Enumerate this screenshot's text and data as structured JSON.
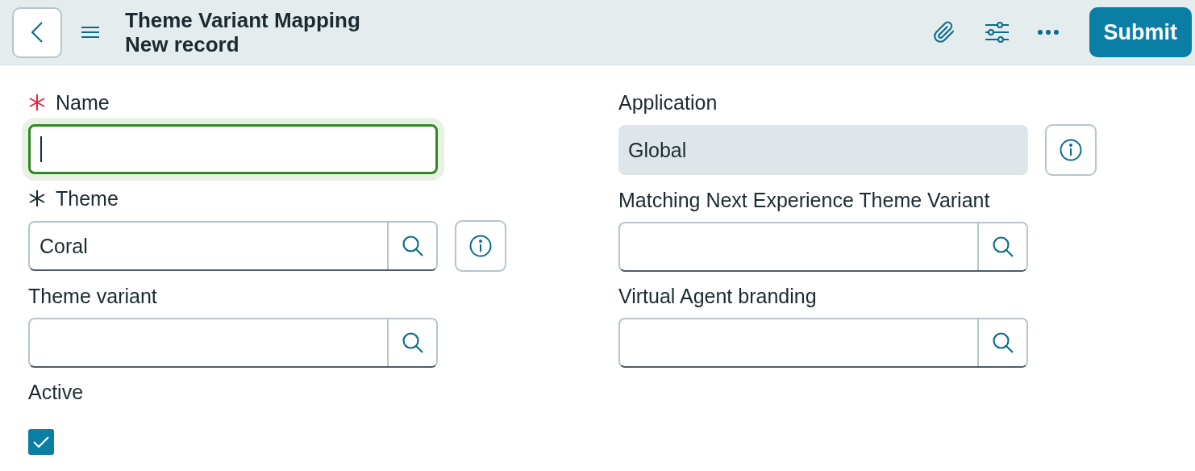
{
  "header": {
    "title": "Theme Variant Mapping",
    "subtitle": "New record",
    "submit": "Submit"
  },
  "columns": [
    {
      "fields": [
        {
          "kind": "text",
          "label": "Name",
          "required": true,
          "focused": true
        },
        {
          "kind": "reference",
          "label": "Theme",
          "required": true,
          "value": "Coral",
          "info": true
        },
        {
          "kind": "reference",
          "label": "Theme variant"
        },
        {
          "kind": "checkbox",
          "label": "Active",
          "checked": true
        }
      ]
    },
    {
      "fields": [
        {
          "kind": "readonly",
          "label": "Application",
          "value": "Global",
          "info": true
        },
        {
          "kind": "reference",
          "label": "Matching Next Experience Theme Variant"
        },
        {
          "kind": "reference",
          "label": "Virtual Agent branding"
        }
      ]
    }
  ]
}
